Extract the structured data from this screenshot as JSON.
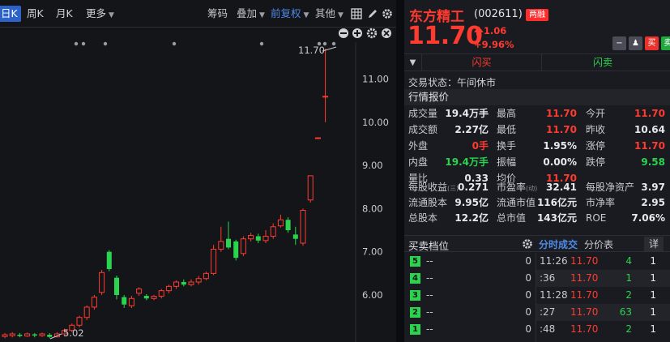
{
  "toolbar": {
    "periods": [
      "日K",
      "周K",
      "月K",
      "更多"
    ],
    "tools": [
      "筹码",
      "叠加",
      "前复权",
      "其他"
    ]
  },
  "chart": {
    "price_labels": [
      "11.00",
      "10.00",
      "9.00",
      "8.00",
      "7.00",
      "6.00"
    ],
    "high_marker": "11.70",
    "low_marker": "5.02",
    "candles": [
      {
        "o": 5.04,
        "c": 5.08,
        "h": 5.12,
        "l": 5.0
      },
      {
        "o": 5.06,
        "c": 5.1,
        "h": 5.14,
        "l": 5.02
      },
      {
        "o": 5.08,
        "c": 5.05,
        "h": 5.12,
        "l": 5.02
      },
      {
        "o": 5.05,
        "c": 5.1,
        "h": 5.13,
        "l": 5.03
      },
      {
        "o": 5.09,
        "c": 5.06,
        "h": 5.12,
        "l": 5.02
      },
      {
        "o": 5.06,
        "c": 5.1,
        "h": 5.13,
        "l": 5.03
      },
      {
        "o": 5.08,
        "c": 5.03,
        "h": 5.12,
        "l": 5.0
      },
      {
        "o": 5.03,
        "c": 5.1,
        "h": 5.14,
        "l": 5.02
      },
      {
        "o": 5.1,
        "c": 5.18,
        "h": 5.22,
        "l": 5.06
      },
      {
        "o": 5.18,
        "c": 5.3,
        "h": 5.34,
        "l": 5.14
      },
      {
        "o": 5.3,
        "c": 5.48,
        "h": 5.52,
        "l": 5.25
      },
      {
        "o": 5.48,
        "c": 5.72,
        "h": 5.76,
        "l": 5.42
      },
      {
        "o": 5.72,
        "c": 5.95,
        "h": 6.0,
        "l": 5.66
      },
      {
        "o": 6.06,
        "c": 6.52,
        "h": 6.58,
        "l": 6.0
      },
      {
        "o": 7.0,
        "c": 6.6,
        "h": 7.04,
        "l": 6.55
      },
      {
        "o": 6.4,
        "c": 6.0,
        "h": 6.45,
        "l": 5.9
      },
      {
        "o": 5.95,
        "c": 5.78,
        "h": 6.0,
        "l": 5.7
      },
      {
        "o": 5.75,
        "c": 5.92,
        "h": 5.98,
        "l": 5.7
      },
      {
        "o": 6.04,
        "c": 6.14,
        "h": 6.18,
        "l": 5.98
      },
      {
        "o": 5.98,
        "c": 5.92,
        "h": 6.02,
        "l": 5.88
      },
      {
        "o": 5.92,
        "c": 5.97,
        "h": 6.0,
        "l": 5.88
      },
      {
        "o": 5.97,
        "c": 6.1,
        "h": 6.14,
        "l": 5.92
      },
      {
        "o": 6.1,
        "c": 6.2,
        "h": 6.24,
        "l": 6.04
      },
      {
        "o": 6.2,
        "c": 6.3,
        "h": 6.34,
        "l": 6.14
      },
      {
        "o": 6.3,
        "c": 6.24,
        "h": 6.36,
        "l": 6.2
      },
      {
        "o": 6.24,
        "c": 6.3,
        "h": 6.36,
        "l": 6.2
      },
      {
        "o": 6.3,
        "c": 6.38,
        "h": 6.44,
        "l": 6.24
      },
      {
        "o": 6.38,
        "c": 6.5,
        "h": 6.54,
        "l": 6.34
      },
      {
        "o": 6.5,
        "c": 7.06,
        "h": 7.16,
        "l": 6.46
      },
      {
        "o": 7.06,
        "c": 7.24,
        "h": 7.58,
        "l": 7.0
      },
      {
        "o": 7.3,
        "c": 7.1,
        "h": 7.7,
        "l": 7.06
      },
      {
        "o": 7.24,
        "c": 6.86,
        "h": 7.28,
        "l": 6.8
      },
      {
        "o": 6.96,
        "c": 7.3,
        "h": 7.36,
        "l": 6.9
      },
      {
        "o": 7.3,
        "c": 7.38,
        "h": 7.44,
        "l": 7.24
      },
      {
        "o": 7.36,
        "c": 7.26,
        "h": 7.42,
        "l": 7.2
      },
      {
        "o": 7.26,
        "c": 7.36,
        "h": 7.5,
        "l": 7.2
      },
      {
        "o": 7.36,
        "c": 7.58,
        "h": 7.66,
        "l": 7.3
      },
      {
        "o": 7.6,
        "c": 7.74,
        "h": 7.86,
        "l": 7.56
      },
      {
        "o": 7.74,
        "c": 7.5,
        "h": 7.8,
        "l": 7.44
      },
      {
        "o": 7.4,
        "c": 7.3,
        "h": 7.58,
        "l": 7.16
      },
      {
        "o": 7.2,
        "c": 7.96,
        "h": 8.0,
        "l": 7.14
      },
      {
        "o": 8.2,
        "c": 8.76,
        "h": 8.76,
        "l": 8.14
      },
      {
        "o": 9.64,
        "c": 9.64,
        "h": 9.64,
        "l": 9.64
      },
      {
        "o": 10.6,
        "c": 10.6,
        "h": 11.7,
        "l": 10.0
      }
    ]
  },
  "quote": {
    "name": "东方精工",
    "code": "(002611)",
    "badge": "两融",
    "price": "11.70",
    "change": "1.06",
    "change_pct": "+9.96%",
    "side_buttons": [
      "买",
      "卖"
    ],
    "flash_buy": "闪买",
    "flash_sell": "闪卖",
    "status_label": "交易状态：",
    "status_value": "午间休市",
    "section_quote": "行情报价",
    "rows": [
      {
        "l1": "成交量",
        "v1": "19.4万手",
        "c1": "white",
        "l2": "最高",
        "v2": "11.70",
        "c2": "red",
        "l3": "今开",
        "v3": "11.70",
        "c3": "red"
      },
      {
        "l1": "成交额",
        "v1": "2.27亿",
        "c1": "white",
        "l2": "最低",
        "v2": "11.70",
        "c2": "red",
        "l3": "昨收",
        "v3": "10.64",
        "c3": "white"
      },
      {
        "l1": "外盘",
        "v1": "0手",
        "c1": "red",
        "l2": "换手",
        "v2": "1.95%",
        "c2": "white",
        "l3": "涨停",
        "v3": "11.70",
        "c3": "red"
      },
      {
        "l1": "内盘",
        "v1": "19.4万手",
        "c1": "green",
        "l2": "振幅",
        "v2": "0.00%",
        "c2": "white",
        "l3": "跌停",
        "v3": "9.58",
        "c3": "green"
      },
      {
        "l1": "量比",
        "v1": "0.33",
        "c1": "white",
        "l2": "均价",
        "v2": "11.70",
        "c2": "red",
        "l3": "",
        "v3": "",
        "c3": "white"
      }
    ],
    "fin_rows": [
      {
        "l1": "每股收益",
        "sup": "(三)",
        "v1": "0.271",
        "l2": "市盈率",
        "sup2": "(动)",
        "v2": "32.41",
        "l3": "每股净资产",
        "v3": "3.97"
      },
      {
        "l1": "流通股本",
        "v1": "9.95亿",
        "l2": "流通市值",
        "v2": "116亿元",
        "l3": "市净率",
        "v3": "2.95"
      },
      {
        "l1": "总股本",
        "v1": "12.2亿",
        "l2": "总市值",
        "v2": "143亿元",
        "l3": "ROE",
        "v3": "7.06%"
      }
    ],
    "bid_title": "买卖档位",
    "tick_tabs": [
      "分时成交",
      "分价表"
    ],
    "detail_btn": "详",
    "levels": [
      {
        "n": "5",
        "p": "--",
        "v": "0"
      },
      {
        "n": "4",
        "p": "--",
        "v": "0"
      },
      {
        "n": "3",
        "p": "--",
        "v": "0"
      },
      {
        "n": "2",
        "p": "--",
        "v": "0"
      },
      {
        "n": "1",
        "p": "--",
        "v": "0"
      }
    ],
    "ticks": [
      {
        "t": "11:26",
        "p": "11.70",
        "v": "4",
        "n": "1"
      },
      {
        "t": ":36",
        "p": "11.70",
        "v": "1",
        "n": "1"
      },
      {
        "t": "11:28",
        "p": "11.70",
        "v": "2",
        "n": "1"
      },
      {
        "t": ":27",
        "p": "11.70",
        "v": "63",
        "n": "1"
      },
      {
        "t": ":48",
        "p": "11.70",
        "v": "2",
        "n": "1"
      }
    ]
  }
}
